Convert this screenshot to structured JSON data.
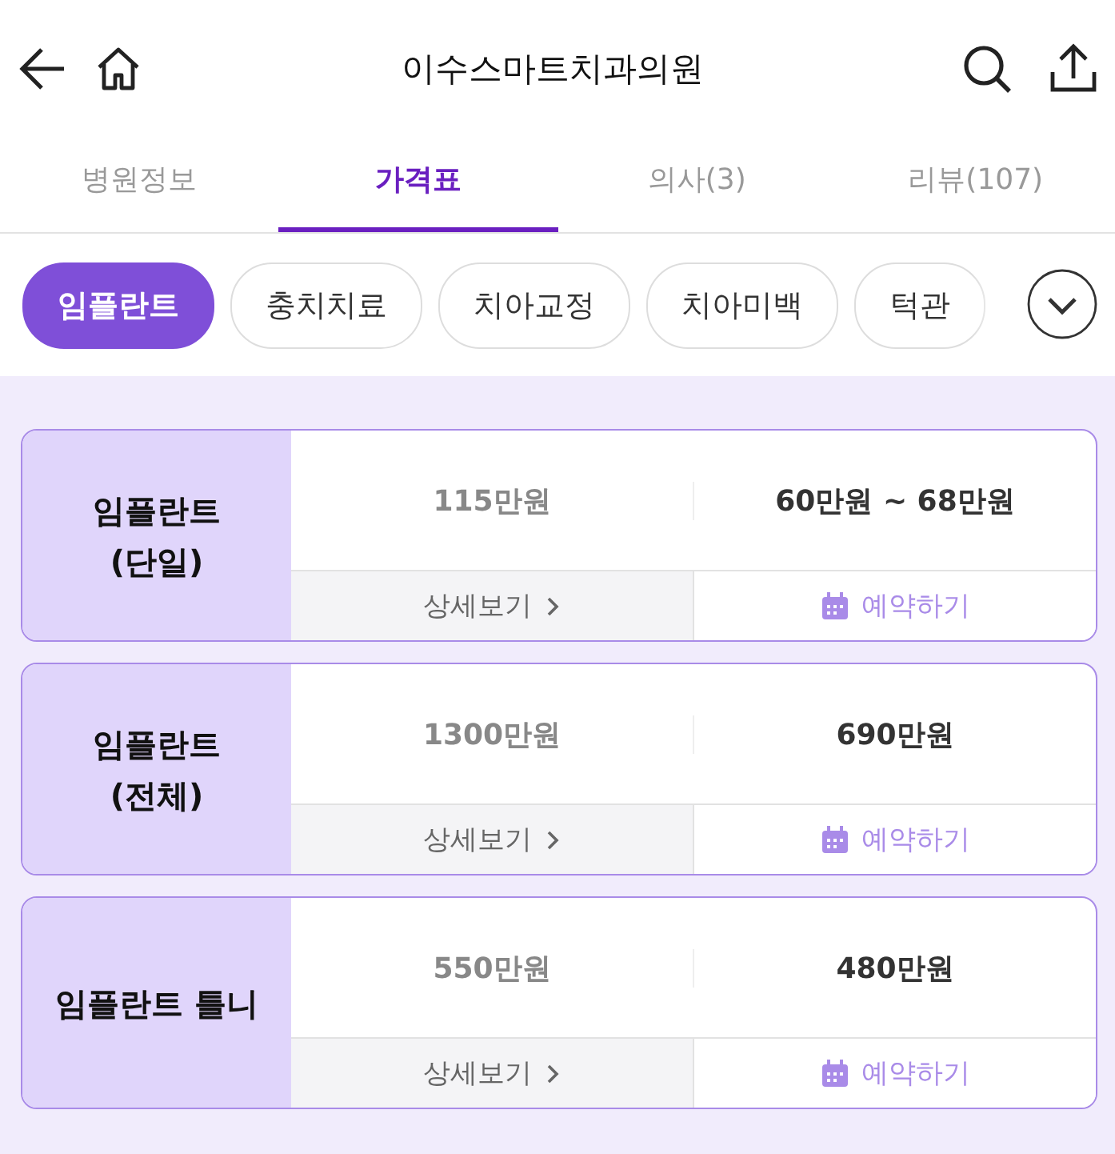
{
  "header": {
    "title": "이수스마트치과의원"
  },
  "tabs": [
    {
      "label": "병원정보",
      "selected": false
    },
    {
      "label": "가격표",
      "selected": true
    },
    {
      "label": "의사(3)",
      "selected": false
    },
    {
      "label": "리뷰(107)",
      "selected": false
    }
  ],
  "chips": [
    {
      "label": "임플란트",
      "selected": true
    },
    {
      "label": "충치치료",
      "selected": false
    },
    {
      "label": "치아교정",
      "selected": false
    },
    {
      "label": "치아미백",
      "selected": false
    },
    {
      "label": "턱관",
      "selected": false
    }
  ],
  "prices": [
    {
      "name": "임플란트\n(단일)",
      "regular": "115만원",
      "price": "60만원 ~ 68만원",
      "detail": "상세보기",
      "reserve": "예약하기"
    },
    {
      "name": "임플란트\n(전체)",
      "regular": "1300만원",
      "price": "690만원",
      "detail": "상세보기",
      "reserve": "예약하기"
    },
    {
      "name": "임플란트 틀니",
      "regular": "550만원",
      "price": "480만원",
      "detail": "상세보기",
      "reserve": "예약하기"
    }
  ]
}
